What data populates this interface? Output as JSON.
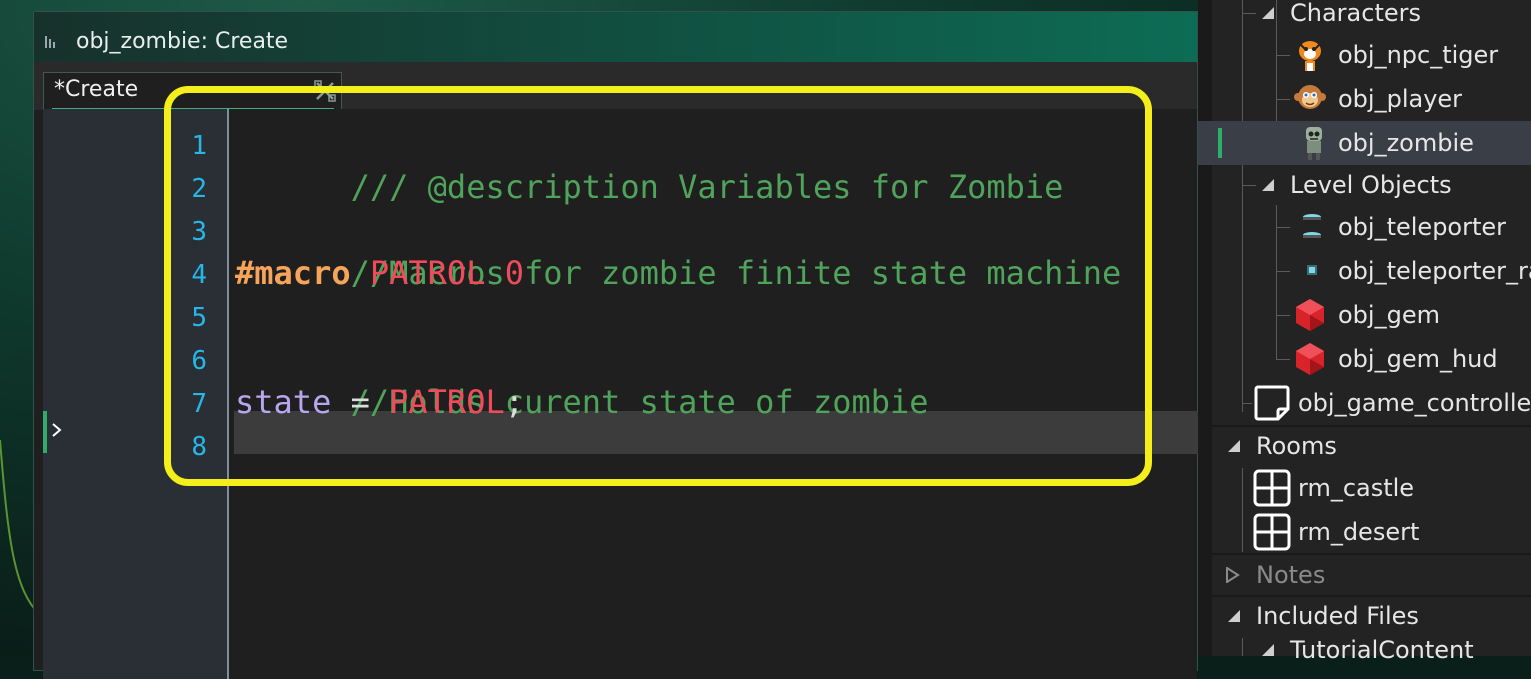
{
  "editor": {
    "window_title": "obj_zombie: Create",
    "tab_label": "*Create",
    "line_numbers": [
      "1",
      "2",
      "3",
      "4",
      "5",
      "6",
      "7",
      "8"
    ],
    "code": {
      "line1": "/// @description Variables for Zombie",
      "line3": "//Macros for zombie finite state machine",
      "line4_keyword": "#macro",
      "line4_name": "PATROL",
      "line4_value": "0",
      "line6": "//Holds curent state of zombie",
      "line7_var": "state",
      "line7_op": " = ",
      "line7_value": "PATROL",
      "line7_end": ";"
    }
  },
  "tree": {
    "characters": "Characters",
    "npc_tiger": "obj_npc_tiger",
    "player": "obj_player",
    "zombie": "obj_zombie",
    "level_objects": "Level Objects",
    "teleporter": "obj_teleporter",
    "teleporter_ray": "obj_teleporter_ray",
    "gem": "obj_gem",
    "gem_hud": "obj_gem_hud",
    "game_controller": "obj_game_controller",
    "rooms": "Rooms",
    "rm_castle": "rm_castle",
    "rm_desert": "rm_desert",
    "notes": "Notes",
    "included_files": "Included Files",
    "tutorial_content": "TutorialContent"
  },
  "colors": {
    "highlight": "#f4ee1a",
    "line_number": "#27b6e8",
    "comment": "#4fa35a",
    "macro": "#f5a45a",
    "constant": "#f04b5a",
    "variable": "#b7a7ee",
    "selection_accent": "#2fae6a"
  }
}
